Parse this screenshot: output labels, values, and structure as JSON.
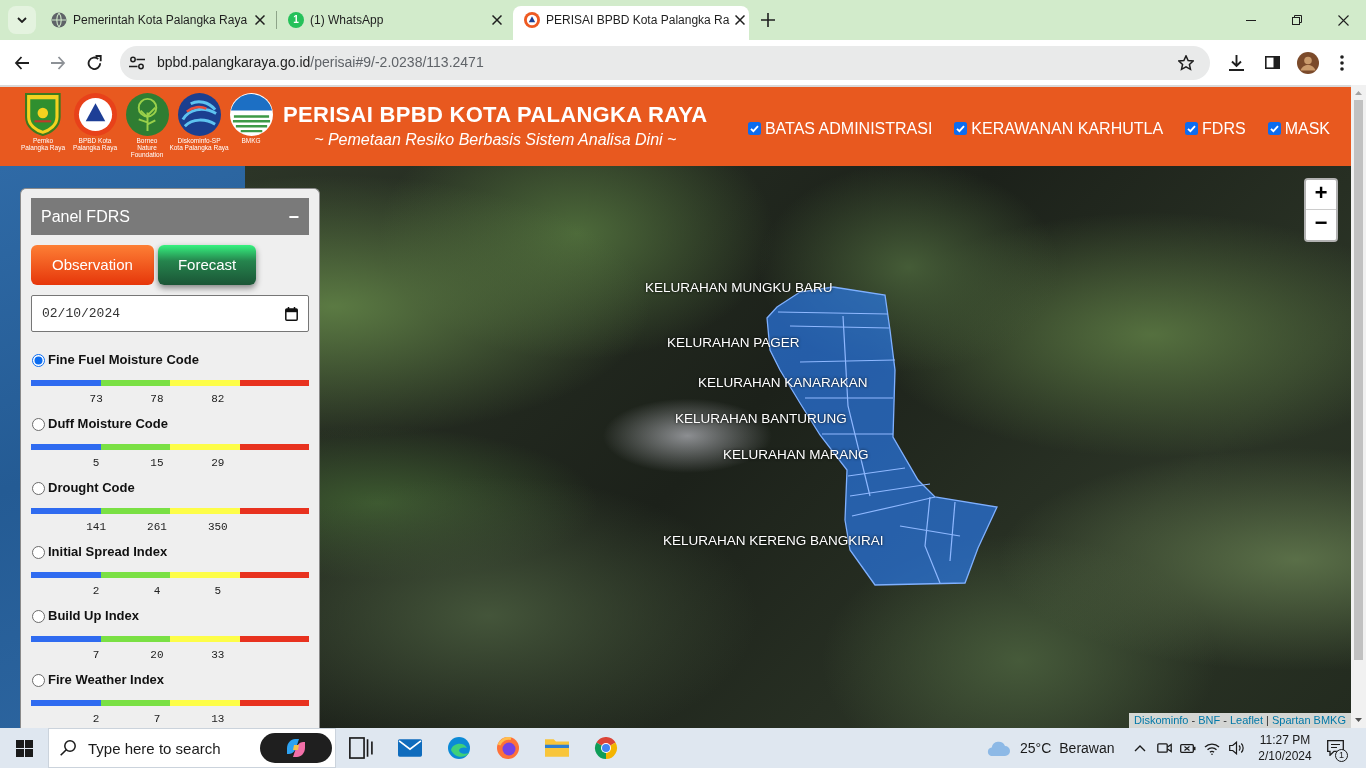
{
  "browser": {
    "tabs": [
      {
        "title": "Pemerintah Kota Palangka Raya",
        "kind": "globe",
        "selected": false
      },
      {
        "title": "(1) WhatsApp",
        "kind": "chat",
        "badge": "1",
        "selected": false
      },
      {
        "title": "PERISAI BPBD Kota Palangka Ra",
        "kind": "emblem",
        "selected": true
      }
    ],
    "url": {
      "host": "bpbd.palangkaraya.go.id",
      "path": "/perisai#9/-2.0238/113.2471"
    }
  },
  "site_header": {
    "logos": [
      {
        "kind": "shield",
        "caption": [
          "Pemko",
          "Palangka Raya"
        ]
      },
      {
        "kind": "triangle",
        "caption": [
          "BPBD Kota",
          "Palangka Raya"
        ]
      },
      {
        "kind": "tree",
        "caption": [
          "Borneo",
          "Nature",
          "Foundation"
        ]
      },
      {
        "kind": "swirl",
        "caption": [
          "Diskominfo-SP",
          "Kota Palangka Raya"
        ]
      },
      {
        "kind": "waves",
        "caption": [
          "BMKG"
        ]
      }
    ],
    "title": "PERISAI BPBD KOTA PALANGKA RAYA",
    "subtitle": "~ Pemetaan Resiko Berbasis Sistem Analisa Dini ~",
    "layers": [
      {
        "label": "BATAS ADMINISTRASI",
        "checked": true
      },
      {
        "label": "KERAWANAN KARHUTLA",
        "checked": true
      },
      {
        "label": "FDRS",
        "checked": true
      },
      {
        "label": "MASK",
        "checked": true
      }
    ]
  },
  "map": {
    "labels": [
      "KELURAHAN MUNGKU BARU",
      "KELURAHAN PAGER",
      "KELURAHAN KANARAKAN",
      "KELURAHAN BANTURUNG",
      "KELURAHAN MARANG",
      "KELURAHAN KERENG BANGKIRAI"
    ],
    "zoom": [
      "+",
      "−"
    ],
    "attribution": [
      {
        "text": "Diskominfo",
        "kind": "link"
      },
      {
        "text": "-",
        "kind": "separator"
      },
      {
        "text": "BNF",
        "kind": "link"
      },
      {
        "text": "-",
        "kind": "separator"
      },
      {
        "text": "Leaflet",
        "kind": "link"
      },
      {
        "text": "|",
        "kind": "separator"
      },
      {
        "text": "Spartan BMKG",
        "kind": "link"
      }
    ]
  },
  "panel": {
    "title": "Panel FDRS",
    "collapse": "−",
    "modes": [
      {
        "label": "Observation",
        "kind": "orange"
      },
      {
        "label": "Forecast",
        "kind": "green"
      }
    ],
    "date": "02/10/2024",
    "indices": [
      {
        "label": "Fine Fuel Moisture Code",
        "selected": true,
        "ticks": [
          "73",
          "78",
          "82"
        ]
      },
      {
        "label": "Duff Moisture Code",
        "selected": false,
        "ticks": [
          "5",
          "15",
          "29"
        ]
      },
      {
        "label": "Drought Code",
        "selected": false,
        "ticks": [
          "141",
          "261",
          "350"
        ]
      },
      {
        "label": "Initial Spread Index",
        "selected": false,
        "ticks": [
          "2",
          "4",
          "5"
        ]
      },
      {
        "label": "Build Up Index",
        "selected": false,
        "ticks": [
          "7",
          "20",
          "33"
        ]
      },
      {
        "label": "Fire Weather Index",
        "selected": false,
        "ticks": [
          "2",
          "7",
          "13"
        ]
      }
    ]
  },
  "taskbar": {
    "search": {
      "placeholder": "Type here to search"
    },
    "apps": [
      {
        "kind": "taskview"
      },
      {
        "kind": "mail"
      },
      {
        "kind": "edge"
      },
      {
        "kind": "firefox"
      },
      {
        "kind": "files"
      },
      {
        "kind": "chrome"
      }
    ],
    "weather": {
      "temperature": "25°C",
      "condition": "Berawan"
    },
    "clock": {
      "time": "11:27 PM",
      "date": "2/10/2024"
    },
    "notifications": "1"
  }
}
